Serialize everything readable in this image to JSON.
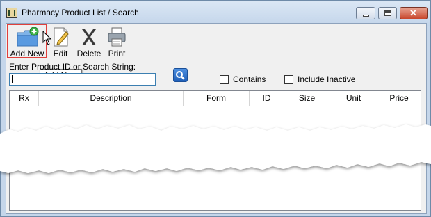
{
  "window": {
    "title": "Pharmacy Product List / Search"
  },
  "toolbar": {
    "add_label": "Add New",
    "edit_label": "Edit",
    "delete_label": "Delete",
    "print_label": "Print"
  },
  "tooltip": {
    "text": "Add New"
  },
  "search": {
    "label": "Enter Product ID or Search String:",
    "value": ""
  },
  "filters": {
    "contains_label": "Contains",
    "contains_checked": false,
    "inactive_label": "Include Inactive",
    "inactive_checked": false
  },
  "grid": {
    "columns": [
      "Rx",
      "Description",
      "Form",
      "ID",
      "Size",
      "Unit",
      "Price"
    ],
    "rows": []
  },
  "colors": {
    "highlight_border": "#e0403c",
    "search_button": "#2b6fcf",
    "input_border": "#3c7fb1"
  }
}
